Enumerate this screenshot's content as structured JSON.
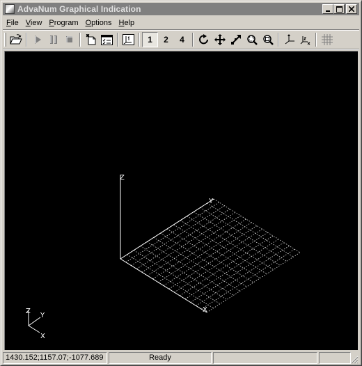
{
  "window": {
    "title": "AdvaNum Graphical  Indication",
    "controls": {
      "minimize": "_",
      "maximize": "□",
      "close": "×"
    }
  },
  "menu": [
    {
      "label": "File",
      "accel": "F",
      "rest": "ile"
    },
    {
      "label": "View",
      "accel": "V",
      "rest": "iew"
    },
    {
      "label": "Program",
      "accel": "P",
      "rest": "rogram"
    },
    {
      "label": "Options",
      "accel": "O",
      "rest": "ptions"
    },
    {
      "label": "Help",
      "accel": "H",
      "rest": "elp"
    }
  ],
  "toolbar": {
    "open": {
      "icon": "open-folder-icon"
    },
    "run": {
      "icon": "play-icon",
      "enabled": false
    },
    "pause": {
      "icon": "pause-icon",
      "enabled": false
    },
    "stop": {
      "icon": "stop-icon",
      "enabled": false
    },
    "new_program": {
      "icon": "new-document-icon"
    },
    "checklist": {
      "icon": "checklist-icon"
    },
    "show_axes": {
      "icon": "axes-frame-icon"
    },
    "view1_label": "1",
    "view2_label": "2",
    "view4_label": "4",
    "rotate": {
      "icon": "rotate-icon"
    },
    "pan": {
      "icon": "pan-icon"
    },
    "zoom_extents": {
      "icon": "zoom-extents-icon"
    },
    "zoom_window": {
      "icon": "zoom-window-icon"
    },
    "zoom": {
      "icon": "zoom-icon"
    },
    "axes": {
      "icon": "axes-icon"
    },
    "axes_labeled": {
      "icon": "axes-labeled-icon"
    },
    "grid": {
      "icon": "grid-icon"
    }
  },
  "scene": {
    "axis_labels": {
      "z": "Z",
      "y": "Y",
      "x": "X"
    },
    "triad_labels": {
      "z": "Z",
      "y": "Y",
      "x": "X"
    },
    "colors": {
      "background": "#000000",
      "lines": "#ffffff"
    }
  },
  "statusbar": {
    "coords": "1430.152;1157.07;-1077.689",
    "status": "Ready",
    "pane3": "",
    "pane4": ""
  }
}
